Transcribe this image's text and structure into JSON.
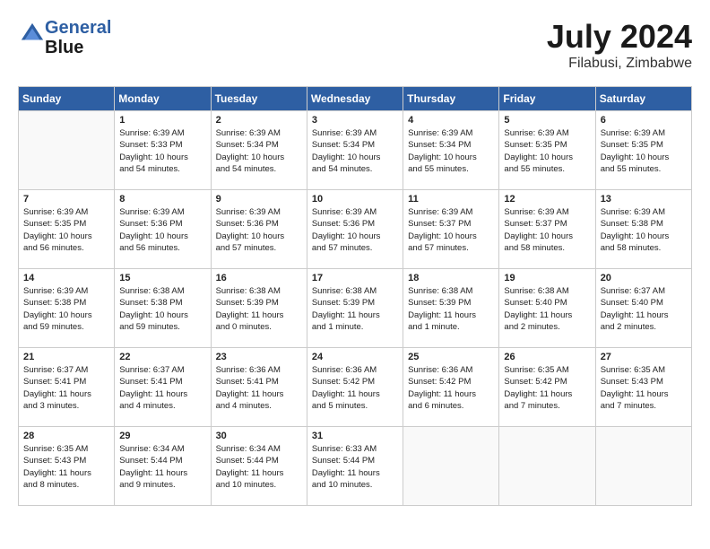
{
  "header": {
    "logo_line1": "General",
    "logo_line2": "Blue",
    "month_year": "July 2024",
    "location": "Filabusi, Zimbabwe"
  },
  "days_of_week": [
    "Sunday",
    "Monday",
    "Tuesday",
    "Wednesday",
    "Thursday",
    "Friday",
    "Saturday"
  ],
  "weeks": [
    [
      {
        "day": "",
        "detail": ""
      },
      {
        "day": "1",
        "detail": "Sunrise: 6:39 AM\nSunset: 5:33 PM\nDaylight: 10 hours\nand 54 minutes."
      },
      {
        "day": "2",
        "detail": "Sunrise: 6:39 AM\nSunset: 5:34 PM\nDaylight: 10 hours\nand 54 minutes."
      },
      {
        "day": "3",
        "detail": "Sunrise: 6:39 AM\nSunset: 5:34 PM\nDaylight: 10 hours\nand 54 minutes."
      },
      {
        "day": "4",
        "detail": "Sunrise: 6:39 AM\nSunset: 5:34 PM\nDaylight: 10 hours\nand 55 minutes."
      },
      {
        "day": "5",
        "detail": "Sunrise: 6:39 AM\nSunset: 5:35 PM\nDaylight: 10 hours\nand 55 minutes."
      },
      {
        "day": "6",
        "detail": "Sunrise: 6:39 AM\nSunset: 5:35 PM\nDaylight: 10 hours\nand 55 minutes."
      }
    ],
    [
      {
        "day": "7",
        "detail": "Sunrise: 6:39 AM\nSunset: 5:35 PM\nDaylight: 10 hours\nand 56 minutes."
      },
      {
        "day": "8",
        "detail": "Sunrise: 6:39 AM\nSunset: 5:36 PM\nDaylight: 10 hours\nand 56 minutes."
      },
      {
        "day": "9",
        "detail": "Sunrise: 6:39 AM\nSunset: 5:36 PM\nDaylight: 10 hours\nand 57 minutes."
      },
      {
        "day": "10",
        "detail": "Sunrise: 6:39 AM\nSunset: 5:36 PM\nDaylight: 10 hours\nand 57 minutes."
      },
      {
        "day": "11",
        "detail": "Sunrise: 6:39 AM\nSunset: 5:37 PM\nDaylight: 10 hours\nand 57 minutes."
      },
      {
        "day": "12",
        "detail": "Sunrise: 6:39 AM\nSunset: 5:37 PM\nDaylight: 10 hours\nand 58 minutes."
      },
      {
        "day": "13",
        "detail": "Sunrise: 6:39 AM\nSunset: 5:38 PM\nDaylight: 10 hours\nand 58 minutes."
      }
    ],
    [
      {
        "day": "14",
        "detail": "Sunrise: 6:39 AM\nSunset: 5:38 PM\nDaylight: 10 hours\nand 59 minutes."
      },
      {
        "day": "15",
        "detail": "Sunrise: 6:38 AM\nSunset: 5:38 PM\nDaylight: 10 hours\nand 59 minutes."
      },
      {
        "day": "16",
        "detail": "Sunrise: 6:38 AM\nSunset: 5:39 PM\nDaylight: 11 hours\nand 0 minutes."
      },
      {
        "day": "17",
        "detail": "Sunrise: 6:38 AM\nSunset: 5:39 PM\nDaylight: 11 hours\nand 1 minute."
      },
      {
        "day": "18",
        "detail": "Sunrise: 6:38 AM\nSunset: 5:39 PM\nDaylight: 11 hours\nand 1 minute."
      },
      {
        "day": "19",
        "detail": "Sunrise: 6:38 AM\nSunset: 5:40 PM\nDaylight: 11 hours\nand 2 minutes."
      },
      {
        "day": "20",
        "detail": "Sunrise: 6:37 AM\nSunset: 5:40 PM\nDaylight: 11 hours\nand 2 minutes."
      }
    ],
    [
      {
        "day": "21",
        "detail": "Sunrise: 6:37 AM\nSunset: 5:41 PM\nDaylight: 11 hours\nand 3 minutes."
      },
      {
        "day": "22",
        "detail": "Sunrise: 6:37 AM\nSunset: 5:41 PM\nDaylight: 11 hours\nand 4 minutes."
      },
      {
        "day": "23",
        "detail": "Sunrise: 6:36 AM\nSunset: 5:41 PM\nDaylight: 11 hours\nand 4 minutes."
      },
      {
        "day": "24",
        "detail": "Sunrise: 6:36 AM\nSunset: 5:42 PM\nDaylight: 11 hours\nand 5 minutes."
      },
      {
        "day": "25",
        "detail": "Sunrise: 6:36 AM\nSunset: 5:42 PM\nDaylight: 11 hours\nand 6 minutes."
      },
      {
        "day": "26",
        "detail": "Sunrise: 6:35 AM\nSunset: 5:42 PM\nDaylight: 11 hours\nand 7 minutes."
      },
      {
        "day": "27",
        "detail": "Sunrise: 6:35 AM\nSunset: 5:43 PM\nDaylight: 11 hours\nand 7 minutes."
      }
    ],
    [
      {
        "day": "28",
        "detail": "Sunrise: 6:35 AM\nSunset: 5:43 PM\nDaylight: 11 hours\nand 8 minutes."
      },
      {
        "day": "29",
        "detail": "Sunrise: 6:34 AM\nSunset: 5:44 PM\nDaylight: 11 hours\nand 9 minutes."
      },
      {
        "day": "30",
        "detail": "Sunrise: 6:34 AM\nSunset: 5:44 PM\nDaylight: 11 hours\nand 10 minutes."
      },
      {
        "day": "31",
        "detail": "Sunrise: 6:33 AM\nSunset: 5:44 PM\nDaylight: 11 hours\nand 10 minutes."
      },
      {
        "day": "",
        "detail": ""
      },
      {
        "day": "",
        "detail": ""
      },
      {
        "day": "",
        "detail": ""
      }
    ]
  ]
}
